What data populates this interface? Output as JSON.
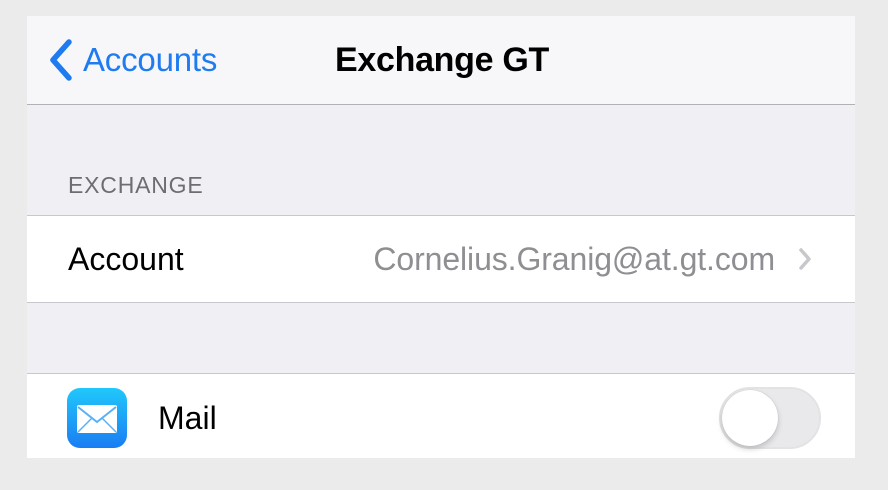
{
  "navbar": {
    "back_label": "Accounts",
    "title": "Exchange GT"
  },
  "section": {
    "header": "EXCHANGE"
  },
  "account_row": {
    "label": "Account",
    "value": "Cornelius.Granig@at.gt.com"
  },
  "mail_row": {
    "icon": "mail-app-icon",
    "label": "Mail",
    "toggle_on": false
  },
  "colors": {
    "accent": "#1e7cf0",
    "background": "#efeff4",
    "secondary_text": "#8e8e93",
    "section_header": "#6d6d72"
  }
}
